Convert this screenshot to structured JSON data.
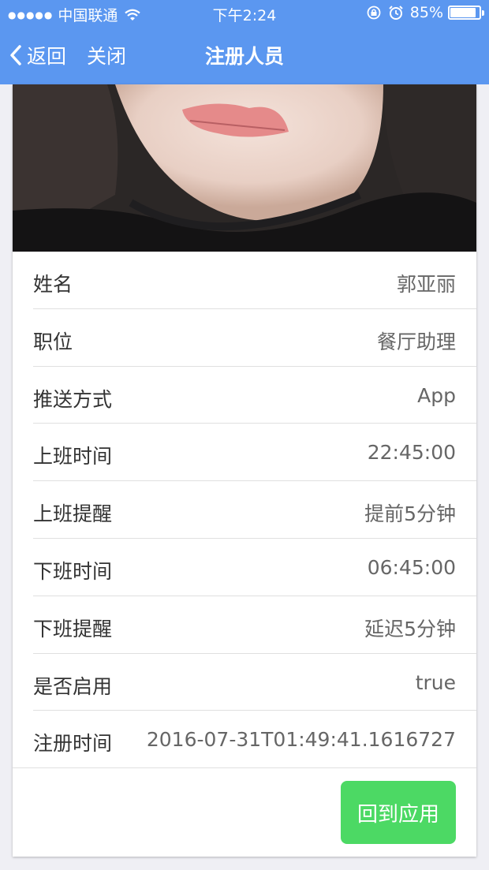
{
  "status_bar": {
    "signal": "●●●●●",
    "carrier": "中国联通",
    "time": "下午2:24",
    "battery_percent": "85%",
    "battery_level": 0.85
  },
  "navbar": {
    "back_label": "返回",
    "close_label": "关闭",
    "title": "注册人员"
  },
  "details": [
    {
      "label": "姓名",
      "value": "郭亚丽"
    },
    {
      "label": "职位",
      "value": "餐厅助理"
    },
    {
      "label": "推送方式",
      "value": "App"
    },
    {
      "label": "上班时间",
      "value": "22:45:00"
    },
    {
      "label": "上班提醒",
      "value": "提前5分钟"
    },
    {
      "label": "下班时间",
      "value": "06:45:00"
    },
    {
      "label": "下班提醒",
      "value": "延迟5分钟"
    },
    {
      "label": "是否启用",
      "value": "true"
    },
    {
      "label": "注册时间",
      "value": "2016-07-31T01:49:41.1616727"
    }
  ],
  "actions": {
    "back_to_app_label": "回到应用"
  },
  "colors": {
    "header": "#5b97f0",
    "action_button": "#4cd964",
    "background": "#efeff4"
  }
}
